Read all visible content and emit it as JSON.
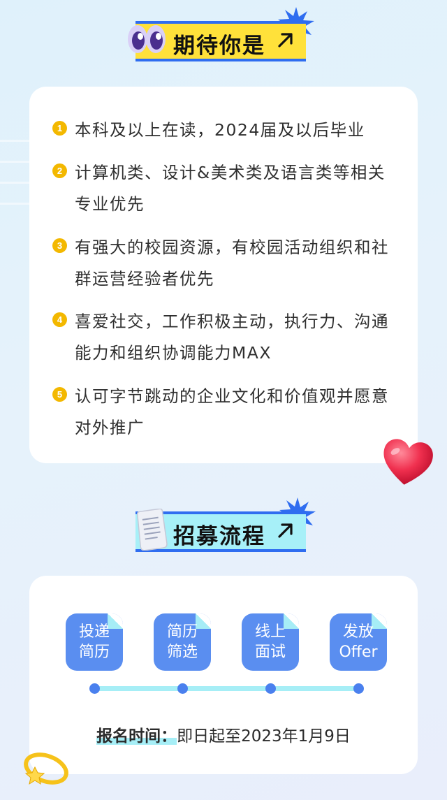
{
  "requirements_section": {
    "title": "期待你是",
    "arrow_icon": "arrow-up-right-icon",
    "items": [
      {
        "num": "1",
        "text": "本科及以上在读，2024届及以后毕业"
      },
      {
        "num": "2",
        "text": "计算机类、设计&美术类及语言类等相关专业优先"
      },
      {
        "num": "3",
        "text": "有强大的校园资源，有校园活动组织和社群运营经验者优先"
      },
      {
        "num": "4",
        "text": "喜爱社交，工作积极主动，执行力、沟通能力和组织协调能力MAX"
      },
      {
        "num": "5",
        "text": "认可字节跳动的企业文化和价值观并愿意对外推广"
      }
    ]
  },
  "process_section": {
    "title": "招募流程",
    "arrow_icon": "arrow-up-right-icon",
    "steps": [
      {
        "line1": "投递",
        "line2": "简历"
      },
      {
        "line1": "简历",
        "line2": "筛选"
      },
      {
        "line1": "线上",
        "line2": "面试"
      },
      {
        "line1": "发放",
        "line2": "Offer"
      }
    ],
    "deadline_label": "报名时间：",
    "deadline_value": "即日起至2023年1月9日"
  },
  "colors": {
    "accent_blue": "#2f6df0",
    "yellow": "#ffe13a",
    "cyan": "#a7f0f8",
    "number_badge": "#f3b800",
    "step_blue": "#5a8ef0"
  }
}
